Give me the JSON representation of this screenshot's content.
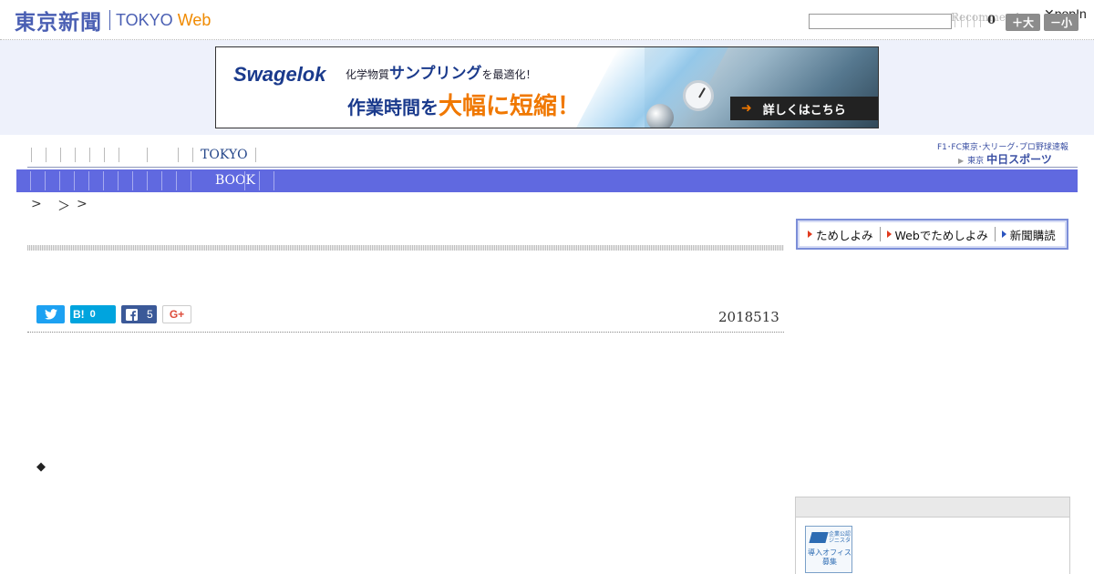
{
  "header": {
    "logo_jp": "東京新聞",
    "logo_en": "TOKYO",
    "logo_web": "Web",
    "recommend_label": "Recommend",
    "popin_label": "popIn",
    "count": "0",
    "font_big_label": "＋大",
    "font_small_label": "－小"
  },
  "banner": {
    "brand": "Swagelok",
    "line1_prefix": "化学物質",
    "line1_em": "サンプリング",
    "line1_suffix": "を最適化！",
    "line2_prefix": "作業時間を",
    "line2_em": "大幅に短縮！",
    "cta": "詳しくはこちら"
  },
  "nav_primary": {
    "tokyo_label": "TOKYO",
    "chunichi_top": "F1･FC東京･大リーグ･プロ野球速報",
    "chunichi_small": "東京",
    "chunichi_brand": "中日スポーツ"
  },
  "nav_secondary": {
    "book_label": "BOOK"
  },
  "breadcrumb": {
    "sep1": ">",
    "sep2": "＞",
    "sep3": ">"
  },
  "article": {
    "date": "2018513",
    "bullet": "◆"
  },
  "share": {
    "hatena_label": "B!",
    "hatena_count": "0",
    "facebook_count": "5",
    "gplus_label": "G+"
  },
  "subscription": {
    "item1": "ためしよみ",
    "item2": "Webでためしよみ",
    "item3": "新聞購読"
  },
  "sidebar_badge": {
    "top_text": "企業公認ジニスタ",
    "bottom_text": "導入オフィス募集"
  },
  "colors": {
    "brand_blue": "#4a5fb3",
    "web_orange": "#f08a00",
    "nav_bar": "#6069e0",
    "twitter": "#1da1f2",
    "hatena": "#00a4de",
    "facebook": "#3b5998"
  },
  "icons": {
    "close": "close-icon",
    "twitter": "twitter-icon",
    "facebook": "facebook-icon",
    "arrow": "arrow-right-icon"
  }
}
